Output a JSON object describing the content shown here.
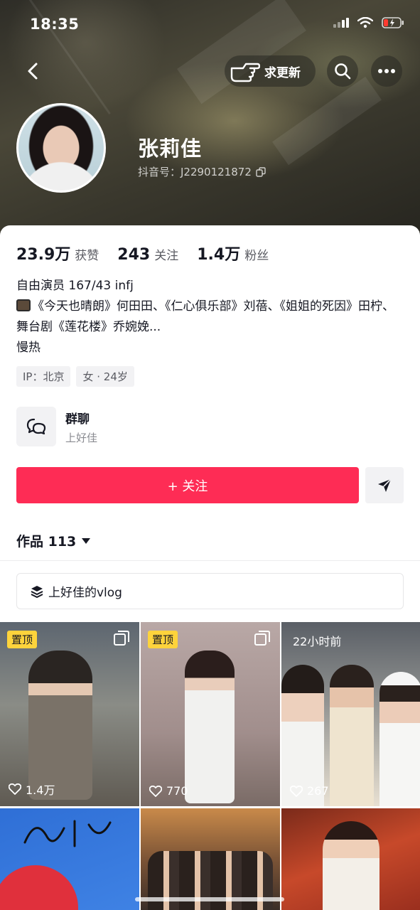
{
  "status_bar": {
    "time": "18:35"
  },
  "nav": {
    "request_update_label": "求更新"
  },
  "profile": {
    "name": "张莉佳",
    "douyin_id": "抖音号：J2290121872"
  },
  "stats": [
    {
      "value": "23.9万",
      "label": "获赞"
    },
    {
      "value": "243",
      "label": "关注"
    },
    {
      "value": "1.4万",
      "label": "粉丝"
    }
  ],
  "bio": {
    "line1": "自由演员 167/43 infj",
    "line2": "《今天也晴朗》何田田、《仁心俱乐部》刘蓓、《姐姐的死因》田柠、舞台剧《莲花楼》乔婉娩...",
    "line3": "慢热"
  },
  "tags": [
    "IP：北京",
    "女 · 24岁"
  ],
  "group": {
    "title": "群聊",
    "subtitle": "上好佳"
  },
  "actions": {
    "follow_label": "+ 关注"
  },
  "works": {
    "label": "作品 113"
  },
  "playlist": {
    "label": "上好佳的vlog"
  },
  "videos": [
    {
      "badge": "置顶",
      "likes": "1.4万",
      "multi": true
    },
    {
      "badge": "置顶",
      "likes": "770",
      "multi": true
    },
    {
      "time": "22小时前",
      "likes": "267"
    },
    {
      "likes": ""
    },
    {
      "likes": ""
    },
    {
      "likes": ""
    }
  ],
  "colors": {
    "accent": "#fe2c55",
    "pin_badge": "#fdd33c"
  }
}
